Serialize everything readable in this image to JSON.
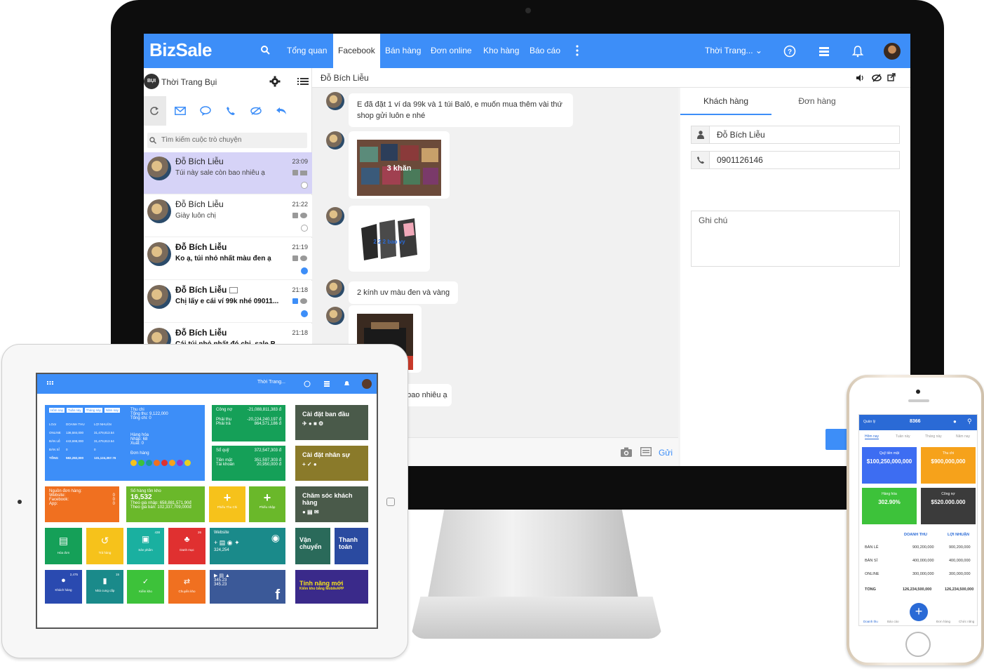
{
  "monitor": {
    "logo": "BizSale",
    "nav": [
      "Tổng quan",
      "Facebook",
      "Bán hàng",
      "Đơn online",
      "Kho hàng",
      "Báo cáo"
    ],
    "store_selector": "Thời Trang...",
    "shop_name": "Thời Trang Bụi",
    "shop_avatar_text": "BỤI",
    "search_placeholder": "Tìm kiếm cuộc trò chuyện",
    "conversations": [
      {
        "name": "Đỗ Bích Liễu",
        "message": "Túi này sale còn bao nhiêu ạ",
        "time": "23:09"
      },
      {
        "name": "Đỗ Bích Liễu",
        "message": "Giày luôn chị",
        "time": "21:22"
      },
      {
        "name": "Đỗ Bích Liễu",
        "message": "Ko ạ, túi nhỏ nhất màu đen ạ",
        "time": "21:19"
      },
      {
        "name": "Đỗ Bích Liễu",
        "message": "Chị lấy e cái ví 99k nhé 09011...",
        "time": "21:18"
      },
      {
        "name": "Đỗ Bích Liễu",
        "message": "Cái túi nhỏ nhất đó chị, sale B...",
        "time": "21:18"
      }
    ],
    "chat_title": "Đỗ Bích Liễu",
    "messages": {
      "first": "E đã đặt 1 ví da 99k và 1 túi Balô, e muốn mua thêm vài thứ shop gửi luôn e nhé",
      "img1_caption": "3 khăn",
      "img2_caption": "2 2 2 bao vy",
      "text2": "2 kính uv màu đen và vàng",
      "text3_fragment": "n bao nhiêu ạ"
    },
    "send_label": "Gửi",
    "right_tabs": [
      "Khách hàng",
      "Đơn hàng"
    ],
    "customer_name": "Đỗ Bích Liễu",
    "customer_phone": "0901126146",
    "note_placeholder": "Ghi chú"
  },
  "tablet": {
    "store_selector": "Thời Trang...",
    "sales_tabs": [
      "Hôm nay",
      "Tuần này",
      "Tháng này",
      "Năm nay"
    ],
    "sales_header": [
      "LOẠI",
      "DOANH THU",
      "LỢI NHUẬN"
    ],
    "sales_rows": [
      [
        "ONLINE",
        "136,584,000",
        "31,479,813.54"
      ],
      [
        "BÁN LẺ",
        "443,698,000",
        "31,479,813.54"
      ],
      [
        "BÁN SỈ",
        "0",
        "0"
      ],
      [
        "TỔNG",
        "582,282,000",
        "131,124,357.76"
      ]
    ],
    "thu_chi": {
      "title": "Thu chi",
      "tong_thu": "Tổng thu: 9,122,000",
      "tong_chi": "Tổng chi: 0",
      "hang_hoa": "Hàng hóa",
      "nhap": "Nhập: 68",
      "xuat": "Xuất: 0",
      "don_hang": "Đơn hàng"
    },
    "cong_no": {
      "title": "Công nợ",
      "value": "-21,088,811,383 đ",
      "phai_thu_label": "Phải thu",
      "phai_thu": "-20,224,240,197 đ",
      "phai_tra_label": "Phải trả",
      "phai_tra": "864,571,186 đ"
    },
    "so_quy": {
      "title": "Sổ quỹ",
      "value": "372,547,303 đ",
      "tien_mat_label": "Tiền mặt",
      "tien_mat": "351,597,303 đ",
      "tai_khoan_label": "Tài khoản",
      "tai_khoan": "20,950,000 đ"
    },
    "nguon": {
      "title": "Nguồn đơn hàng:",
      "website": "Website:",
      "facebook": "Facebook:",
      "app": "App:",
      "v0": "0"
    },
    "ton_kho": {
      "title": "Số hàng tồn kho",
      "value": "16,532",
      "gia_nhap": "Theo giá nhập: 658,881,571,90đ",
      "gia_ban": "Theo giá bán: 102,337,709,000đ"
    },
    "phieu_thu_chi": "Phiếu Thu Chi",
    "phieu_nhap": "Phiếu nhập",
    "icons_row1": [
      "Hóa đơn",
      "Trả hàng",
      "Sản phẩm",
      "Danh mục"
    ],
    "icons_row1_badges": [
      "",
      "",
      "438",
      "26"
    ],
    "website_title": "Website",
    "website_count": "324,254",
    "icons_row2": [
      "Khách hàng",
      "Nhà cung cấp",
      "Kiểm kho",
      "Chuyển kho"
    ],
    "icons_row2_badges": [
      "2,475",
      "15",
      "",
      ""
    ],
    "fb_counts": [
      "345.23",
      "345.23"
    ],
    "dark_tiles": [
      "Cài đặt ban đầu",
      "Cài đặt nhân sự",
      "Chăm sóc khách hàng",
      "Vận chuyển",
      "Thanh toán",
      "Tính năng mới"
    ],
    "new_feature_sub": "Kiểm kho bằng MobileAPP"
  },
  "phone": {
    "menu": "Quản lý",
    "store_id": "8366",
    "tabs": [
      "Hôm nay",
      "Tuần này",
      "Tháng này",
      "Năm nay"
    ],
    "tiles": [
      {
        "label": "Quỹ tiền mặt",
        "value": "$100,250,000,000",
        "color": "#3d6df2"
      },
      {
        "label": "Thu chi",
        "value": "$900,000,000",
        "color": "#f6a21b"
      },
      {
        "label": "Hàng hóa",
        "value": "302.90%",
        "color": "#3dc23a"
      },
      {
        "label": "Công nợ",
        "value": "$520.000.000",
        "color": "#3b3b3b"
      }
    ],
    "table_header": [
      "DOANH THU",
      "LỢI NHUẬN"
    ],
    "table_rows": [
      [
        "BÁN LẺ",
        "900,200,000",
        "900,200,000"
      ],
      [
        "BÁN SỈ",
        "400,000,000",
        "400,000,000"
      ],
      [
        "ONLINE",
        "300,000,000",
        "300,000,000"
      ],
      [
        "TỔNG",
        "126,234,500,000",
        "126,234,500,000"
      ]
    ],
    "bottom_nav": [
      "Doanh thu",
      "Báo cáo",
      "Đơn hàng",
      "Chức năng"
    ]
  }
}
